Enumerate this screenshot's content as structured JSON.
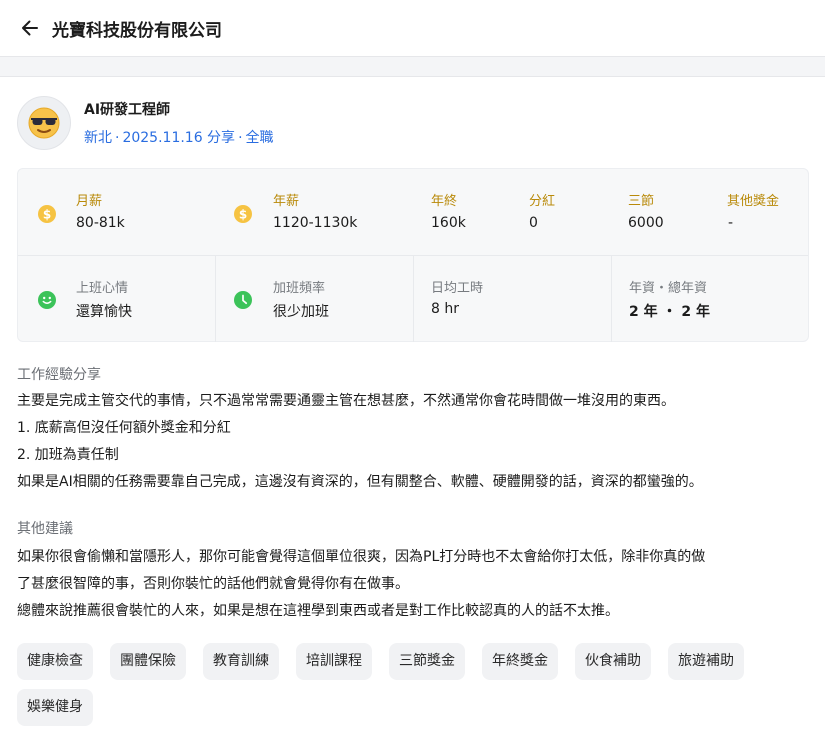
{
  "header": {
    "company_name": "光寶科技股份有限公司"
  },
  "profile": {
    "job_title": "AI研發工程師",
    "location": "新北",
    "date": "2025.11.16 分享",
    "employment_type": "全職"
  },
  "stats": {
    "monthly_salary": {
      "label": "月薪",
      "value": "80-81k"
    },
    "annual_salary": {
      "label": "年薪",
      "value": "1120-1130k"
    },
    "year_end_bonus": {
      "label": "年終",
      "value": "160k"
    },
    "dividend": {
      "label": "分紅",
      "value": "0"
    },
    "festival_bonus": {
      "label": "三節",
      "value": "6000"
    },
    "other_bonus": {
      "label": "其他獎金",
      "value": "-"
    },
    "mood": {
      "label": "上班心情",
      "value": "還算愉快"
    },
    "overtime": {
      "label": "加班頻率",
      "value": "很少加班"
    },
    "daily_hours": {
      "label": "日均工時",
      "value": "8 hr"
    },
    "seniority": {
      "label": "年資・總年資",
      "value": "2 年 ・ 2 年"
    }
  },
  "experience": {
    "title": "工作經驗分享",
    "lines": [
      "主要是完成主管交代的事情，只不過常常需要通靈主管在想甚麼，不然通常你會花時間做一堆沒用的東西。",
      "1. 底薪高但沒任何額外獎金和分紅",
      "2. 加班為責任制",
      "如果是AI相關的任務需要靠自己完成，這邊沒有資深的，但有關整合、軟體、硬體開發的話，資深的都蠻強的。"
    ]
  },
  "advice": {
    "title": "其他建議",
    "lines": [
      "如果你很會偷懶和當隱形人，那你可能會覺得這個單位很爽，因為PL打分時也不太會給你打太低，除非你真的做",
      "了甚麼很智障的事，否則你裝忙的話他們就會覺得你有在做事。",
      "總體來說推薦很會裝忙的人來，如果是想在這裡學到東西或者是對工作比較認真的人的話不太推。"
    ]
  },
  "tags": [
    "健康檢查",
    "團體保險",
    "教育訓練",
    "培訓課程",
    "三節獎金",
    "年終獎金",
    "伙食補助",
    "旅遊補助",
    "娛樂健身"
  ],
  "colors": {
    "accent_blue": "#2a6de0",
    "gold": "#b98a0a",
    "green": "#3cc35a"
  },
  "icons": {
    "back": "arrow-left-icon",
    "avatar": "sunglasses-emoji-icon",
    "salary": "dollar-coin-icon",
    "mood": "smile-icon",
    "overtime": "clock-icon"
  }
}
